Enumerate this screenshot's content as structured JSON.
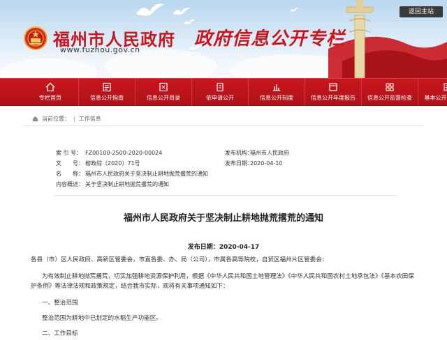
{
  "header": {
    "return_home": "返回主站",
    "site_name": "福州市人民政府",
    "site_url": "www.fuzhou.gov.cn",
    "portal_title": "政府信息公开专栏"
  },
  "colors": {
    "brand_red": "#c8161d",
    "nav_red": "#b0121a"
  },
  "nav": {
    "items": [
      {
        "label": "专栏首页",
        "icon": "home-icon"
      },
      {
        "label": "信息公开指南",
        "icon": "guide-icon"
      },
      {
        "label": "信息公开目录",
        "icon": "catalog-icon"
      },
      {
        "label": "依申请公开",
        "icon": "apply-icon"
      },
      {
        "label": "信息公开制度",
        "icon": "system-icon"
      },
      {
        "label": "信息公开年度报告",
        "icon": "report-icon"
      },
      {
        "label": "信息公开监督检查",
        "icon": "inspect-icon"
      },
      {
        "label": "基本公开制度规定",
        "icon": "rules-icon"
      }
    ]
  },
  "breadcrumb": {
    "location": "当前位置：",
    "current": "工作信息"
  },
  "meta": {
    "index_label": "索 引 号：",
    "index_value": "FZ00100-2500-2020-00024",
    "publisher_label": "发布机构：",
    "publisher_value": "福州市人民政府",
    "docno_label": "文　　号：",
    "docno_value": "榕政综〔2020〕71号",
    "date_label": "发布日期：",
    "date_value": "2020-04-10",
    "name_label": "名　　称：",
    "name_value": "福州市人民政府关于坚决制止耕地抛荒撂荒的通知",
    "summary_label": "内容概述：",
    "summary_value": "关于坚决制止耕地抛荒撂荒的通知"
  },
  "article": {
    "title": "福州市人民政府关于坚决制止耕地抛荒撂荒的通知",
    "pubdate": "发布日期：2020-04-17",
    "p1": "各县（市）区人民政府、高新区管委会，市直各委、办、局（公司），市属各高等院校，自贸区福州片区管委会：",
    "p2": "为有效制止耕地抛荒撂荒，切实加强耕地资源保护利用，根据《中华人民共和国土地管理法》《中华人民共和国农村土地承包法》《基本农田保护条例》等法律法规和政策规定，结合我市实际，现将有关事项通知如下：",
    "p3": "一、整治范围",
    "p4": "整治范围为耕地中已划定的水稻生产功能区。",
    "p5": "二、工作目标"
  }
}
